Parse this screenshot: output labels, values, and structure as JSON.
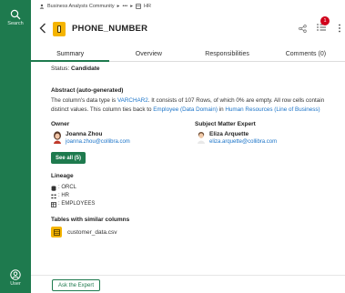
{
  "rail": {
    "search_label": "Search",
    "user_label": "User"
  },
  "breadcrumb": {
    "community": "Business Analysts Community",
    "ellipsis": "•••",
    "domain": "HR"
  },
  "asset": {
    "name": "PHONE_NUMBER"
  },
  "notifications": {
    "count": "1"
  },
  "tabs": [
    {
      "label": "Summary",
      "active": true
    },
    {
      "label": "Overview",
      "active": false
    },
    {
      "label": "Responsibilities",
      "active": false
    },
    {
      "label": "Comments (0)",
      "active": false
    }
  ],
  "summary": {
    "status_label": "Status:",
    "status_value": "Candidate",
    "abstract_title": "Abstract (auto-generated)",
    "abstract_p1": "The column's data type is ",
    "abstract_link1": "VARCHAR2",
    "abstract_p2": ". It consists of 107 Rows, of which 0% are empty. All row cells contain distinct values. This column ties back to ",
    "abstract_link2": "Employee (Data Domain)",
    "abstract_p3": " in ",
    "abstract_link3": "Human Resources",
    "abstract_p4": " ",
    "abstract_link4": "(Line of Business)",
    "owner_title": "Owner",
    "owner_name": "Joanna Zhou",
    "owner_email": "joanna.zhou@collibra.com",
    "sme_title": "Subject Matter Expert",
    "sme_name": "Eliza Arquette",
    "sme_email": "eliza.arquette@collibra.com",
    "see_all_label": "See all (5)",
    "lineage_title": "Lineage",
    "lineage": [
      {
        "icon": "database-icon",
        "label": ": ORCL"
      },
      {
        "icon": "schema-icon",
        "label": ": HR"
      },
      {
        "icon": "table-icon",
        "label": ": EMPLOYEES"
      }
    ],
    "similar_title": "Tables with similar columns",
    "similar_file": "customer_data.csv"
  },
  "footer": {
    "ask_label": "Ask the Expert"
  },
  "colors": {
    "brand_green": "#1e7a4e",
    "asset_yellow": "#f5b400",
    "link_blue": "#1a73c8",
    "badge_red": "#d0021b"
  }
}
